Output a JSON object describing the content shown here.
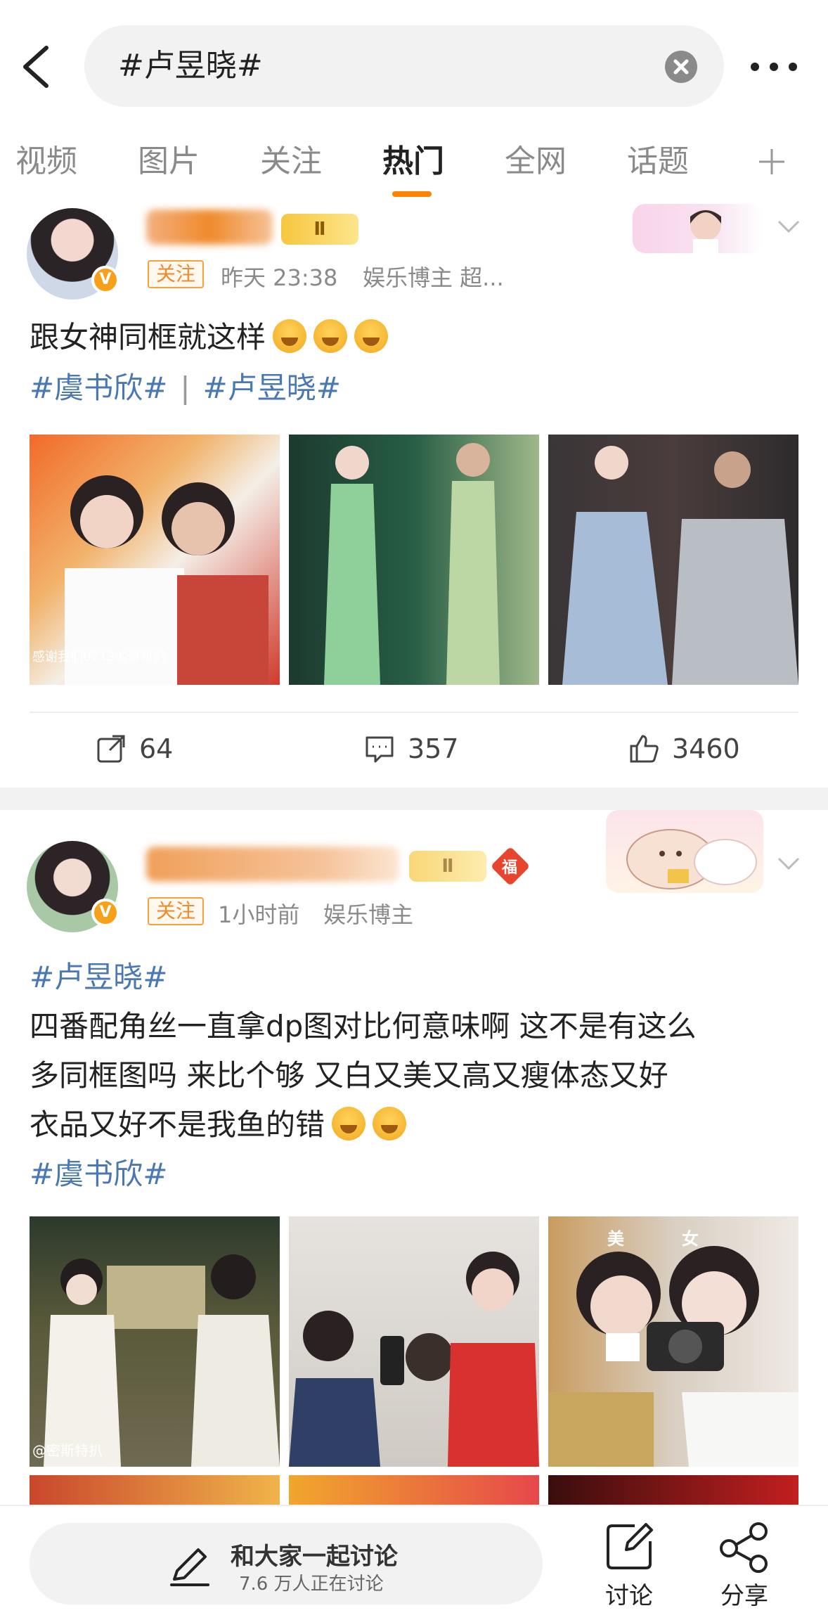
{
  "search": {
    "query": "#卢昱晓#"
  },
  "tabs": [
    {
      "label": "视频"
    },
    {
      "label": "图片"
    },
    {
      "label": "关注"
    },
    {
      "label": "热门"
    },
    {
      "label": "全网"
    },
    {
      "label": "话题"
    }
  ],
  "active_tab": "热门",
  "colors": {
    "accent": "#ff8200",
    "hashtag": "#4a78b3",
    "username": "#f08a2b"
  },
  "post1": {
    "level": "Ⅱ",
    "follow_label": "关注",
    "time": "昨天 23:38",
    "source": "娱乐博主 超...",
    "text": "跟女神同框就这样",
    "hashtags": [
      "#虞书欣#",
      "#卢昱晓#"
    ],
    "image_caption": "感谢我们0713的哥哥们",
    "reposts": "64",
    "comments": "357",
    "likes": "3460"
  },
  "post2": {
    "level": "Ⅱ",
    "fu_badge": "福",
    "follow_label": "关注",
    "time": "1小时前",
    "source": "娱乐博主",
    "hashtag_top": "#卢昱晓#",
    "text_line1": "四番配角丝一直拿dp图对比何意味啊  这不是有这么",
    "text_line2": "多同框图吗  来比个够  又白又美又高又瘦体态又好",
    "text_line3": "衣品又好不是我鱼的错",
    "hashtag_bottom": "#虞书欣#",
    "image_caption": "@密斯特扒",
    "image3_overlay_left": "美",
    "image3_overlay_right": "女"
  },
  "bottom_bar": {
    "discuss_title": "和大家一起讨论",
    "discuss_sub": "7.6 万人正在讨论",
    "discuss_button": "讨论",
    "share_button": "分享"
  }
}
